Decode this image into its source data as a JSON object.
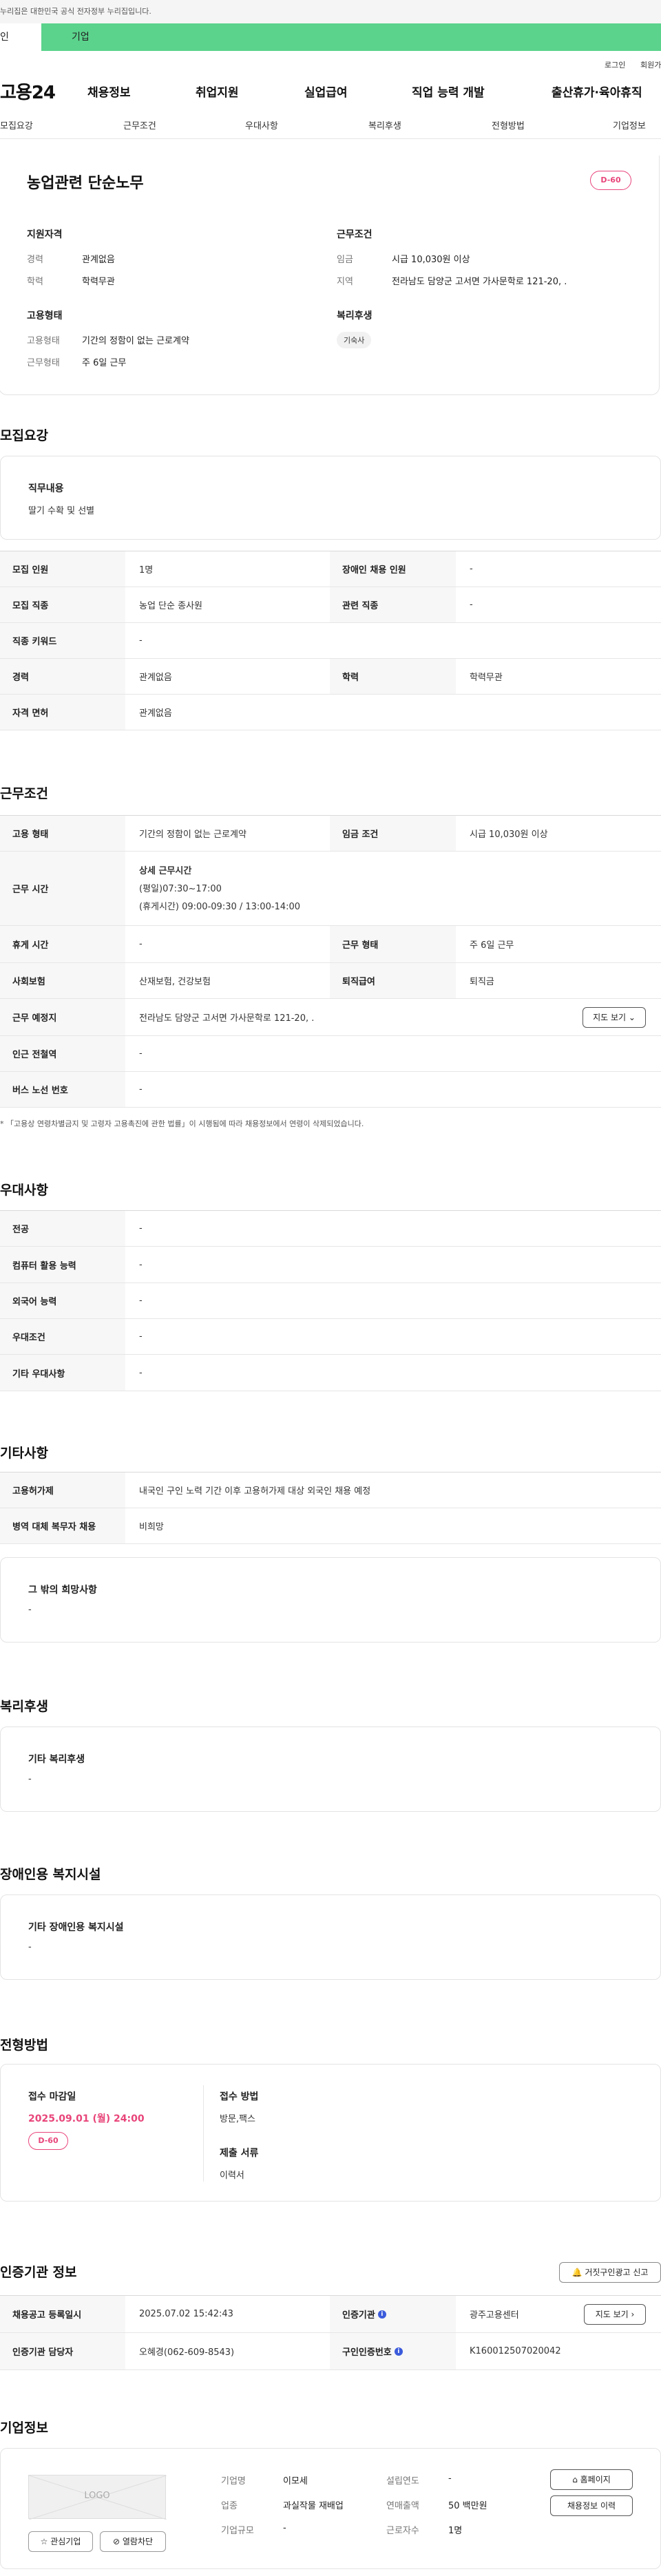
{
  "gov_bar": {
    "text": "누리집은 대한민국 공식 전자정부 누리집입니다."
  },
  "top_tabs": {
    "individual": "인",
    "company": "기업"
  },
  "util": {
    "login": "로그인",
    "join": "회원가입"
  },
  "gnb": {
    "logo": "고용24",
    "menu": [
      "채용정보",
      "취업지원",
      "실업급여",
      "직업 능력 개발",
      "출산휴가·육아휴직"
    ]
  },
  "subnav": [
    "모집요강",
    "근무조건",
    "우대사항",
    "복리후생",
    "전형방법",
    "기업정보"
  ],
  "job": {
    "title": "농업관련 단순노무",
    "dday": "D-60",
    "qual_heading": "지원자격",
    "career_k": "경력",
    "career_v": "관계없음",
    "edu_k": "학력",
    "edu_v": "학력무관",
    "emp_heading": "고용형태",
    "emptype_k": "고용형태",
    "emptype_v": "기간의 정함이 없는 근로계약",
    "worktype_k": "근무형태",
    "worktype_v": "주 6일 근무",
    "cond_heading": "근무조건",
    "wage_k": "임금",
    "wage_v": "시급 10,030원 이상",
    "region_k": "지역",
    "region_v": "전라남도 담양군 고서면 가사문학로 121-20, .",
    "welfare_heading": "복리후생",
    "welfare_chip": "기숙사"
  },
  "recruit": {
    "title": "모집요강",
    "duty_heading": "직무내용",
    "duty_text": "딸기 수확 및 선별",
    "rows": [
      {
        "k1": "모집 인원",
        "v1": "1명",
        "k2": "장애인 채용 인원",
        "v2": "-"
      },
      {
        "k1": "모집 직종",
        "v1": "농업 단순 종사원",
        "k2": "관련 직종",
        "v2": "-"
      },
      {
        "k1": "직종 키워드",
        "v1": "-"
      },
      {
        "k1": "경력",
        "v1": "관계없음",
        "k2": "학력",
        "v2": "학력무관"
      },
      {
        "k1": "자격 면허",
        "v1": "관계없음"
      }
    ]
  },
  "conditions": {
    "title": "근무조건",
    "emp_k": "고용 형태",
    "emp_v": "기간의 정함이 없는 근로계약",
    "wage_k": "임금 조건",
    "wage_v": "시급 10,030원 이상",
    "time_k": "근무 시간",
    "time_detail_h": "상세 근무시간",
    "time_line1": "(평일)07:30~17:00",
    "time_line2": "(휴게시간) 09:00-09:30 / 13:00-14:00",
    "rest_k": "휴게 시간",
    "rest_v": "-",
    "worktype_k": "근무 형태",
    "worktype_v": "주 6일 근무",
    "ins_k": "사회보험",
    "ins_v": "산재보험, 건강보험",
    "sev_k": "퇴직급여",
    "sev_v": "퇴직금",
    "place_k": "근무 예정지",
    "place_v": "전라남도 담양군 고서면 가사문학로 121-20, .",
    "map_btn": "지도 보기",
    "station_k": "인근 전철역",
    "station_v": "-",
    "bus_k": "버스 노선 번호",
    "bus_v": "-",
    "note": "* 「고용상 연령차별금지 및 고령자 고용촉진에 관한 법률」이 시행됨에 따라 채용정보에서 연령이 삭제되었습니다."
  },
  "preferred": {
    "title": "우대사항",
    "rows": [
      {
        "k": "전공",
        "v": "-"
      },
      {
        "k": "컴퓨터 활용 능력",
        "v": "-"
      },
      {
        "k": "외국어 능력",
        "v": "-"
      },
      {
        "k": "우대조건",
        "v": "-"
      },
      {
        "k": "기타 우대사항",
        "v": "-"
      }
    ]
  },
  "etc": {
    "title": "기타사항",
    "rows": [
      {
        "k": "고용허가제",
        "v": "내국인 구인 노력 기간 이후 고용허가제 대상 외국인 채용 예정"
      },
      {
        "k": "병역 대체 복무자 채용",
        "v": "비희망"
      }
    ],
    "other_h": "그 밖의 희망사항",
    "other_v": "-"
  },
  "welfare": {
    "title": "복리후생",
    "h": "기타 복리후생",
    "v": "-"
  },
  "disabled": {
    "title": "장애인용 복지시설",
    "h": "기타 장애인용 복지시설",
    "v": "-"
  },
  "selection": {
    "title": "전형방법",
    "deadline_h": "접수 마감일",
    "deadline_v": "2025.09.01 (월) 24:00",
    "dday": "D-60",
    "method_h": "접수 방법",
    "method_v": "방문,팩스",
    "docs_h": "제출 서류",
    "docs_v": "이력서"
  },
  "cert": {
    "title": "인증기관 정보",
    "report_btn": "거짓구인광고 신고",
    "reg_k": "채용공고 등록일시",
    "reg_v": "2025.07.02 15:42:43",
    "org_k": "인증기관",
    "org_v": "광주고용센터",
    "map_btn": "지도 보기",
    "mgr_k": "인증기관 담당자",
    "mgr_v": "오혜경(062-609-8543)",
    "no_k": "구인인증번호",
    "no_v": "K160012507020042"
  },
  "company": {
    "title": "기업정보",
    "logo": "LOGO",
    "fav_btn": "관심기업",
    "block_btn": "열람차단",
    "name_k": "기업명",
    "name_v": "이모세",
    "found_k": "설립연도",
    "found_v": "-",
    "ind_k": "업종",
    "ind_v": "과실작물 재배업",
    "sales_k": "연매출액",
    "sales_v": "50 백만원",
    "size_k": "기업규모",
    "size_v": "-",
    "emp_k": "근로자수",
    "emp_v": "1명",
    "home_btn": "홈페이지",
    "hist_btn": "채용정보 이력"
  }
}
